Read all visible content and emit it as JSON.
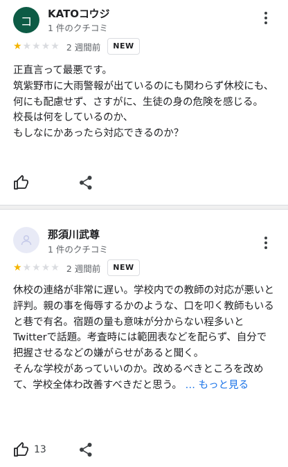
{
  "reviews": [
    {
      "avatar_letter": "コ",
      "name": "KATOコウジ",
      "review_count": "1 件のクチコミ",
      "rating": 1,
      "date": "2 週間前",
      "badge": "NEW",
      "text": "正直言って最悪です。\n筑紫野市に大雨警報が出ているのにも関わらず休校にも、何にも配慮せず、さすがに、生徒の身の危険を感じる。\n校長は何をしているのか、\nもしなにかあったら対応できるのか？",
      "like_count": ""
    },
    {
      "name": "那須川武尊",
      "review_count": "1 件のクチコミ",
      "rating": 1,
      "date": "2 週間前",
      "badge": "NEW",
      "text": "休校の連絡が非常に遅い。学校内での教師の対応が悪いと評判。親の事を侮辱するかのような、口を叩く教師もいると巷で有名。宿題の量も意味が分からない程多いとTwitterで話題。考査時には範囲表などを配らず、自分で把握させるなどの嫌がらせがあると聞く。\nそんな学校があっていいのか。改めるべきところを改めて、学校全体わ改善すべきだと思う。 ",
      "read_more": "… もっと見る",
      "like_count": "13"
    }
  ],
  "icons": {
    "avatar_placeholder": "person-icon",
    "more": "more-vert-icon",
    "star": "star-icon",
    "like": "thumb-up-icon",
    "share": "share-icon"
  },
  "colors": {
    "avatar_bg": "#0d5b45",
    "star_on": "#f4b400",
    "star_off": "#dadce0",
    "link": "#1a73e8"
  }
}
